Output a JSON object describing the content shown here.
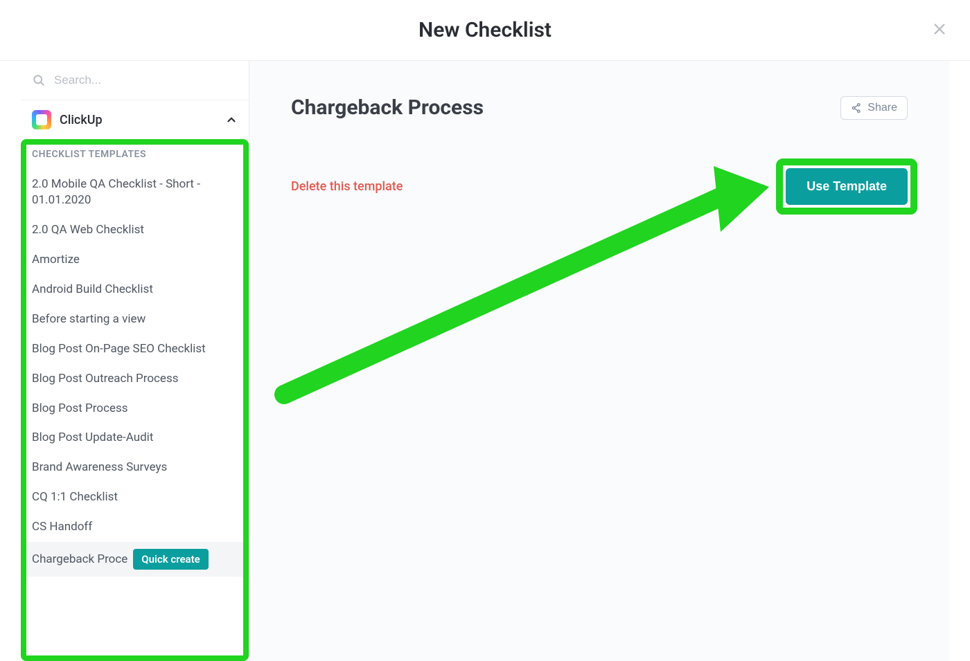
{
  "modal": {
    "title": "New Checklist"
  },
  "annotations": {
    "highlight_color": "#20d420"
  },
  "sidebar": {
    "search_placeholder": "Search...",
    "workspace_name": "ClickUp",
    "section_header": "CHECKLIST TEMPLATES",
    "templates": [
      "2.0 Mobile QA Checklist - Short - 01.01.2020",
      "2.0 QA Web Checklist",
      "Amortize",
      "Android Build Checklist",
      "Before starting a view",
      "Blog Post On-Page SEO Checklist",
      "Blog Post Outreach Process",
      "Blog Post Process",
      "Blog Post Update-Audit",
      "Brand Awareness Surveys",
      "CQ 1:1 Checklist",
      "CS Handoff"
    ],
    "selected_template_truncated": "Chargeback Proce",
    "quick_create_label": "Quick create"
  },
  "main": {
    "template_title": "Chargeback Process",
    "share_label": "Share",
    "delete_label": "Delete this template",
    "use_template_label": "Use Template"
  }
}
